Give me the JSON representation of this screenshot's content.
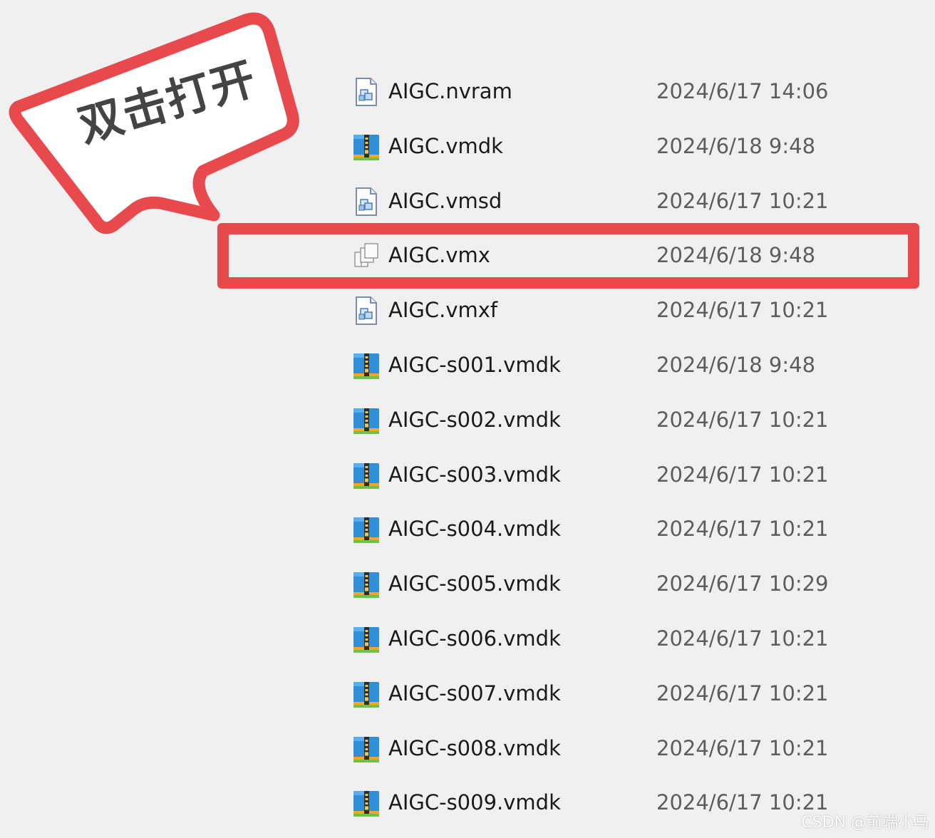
{
  "files": [
    {
      "name": "AIGC.nvram",
      "date": "2024/6/17 14:06",
      "icon": "vm-document-icon"
    },
    {
      "name": "AIGC.vmdk",
      "date": "2024/6/18 9:48",
      "icon": "disk-archive-icon"
    },
    {
      "name": "AIGC.vmsd",
      "date": "2024/6/17 10:21",
      "icon": "vm-document-icon"
    },
    {
      "name": "AIGC.vmx",
      "date": "2024/6/18 9:48",
      "icon": "vm-config-icon"
    },
    {
      "name": "AIGC.vmxf",
      "date": "2024/6/17 10:21",
      "icon": "vm-document-icon"
    },
    {
      "name": "AIGC-s001.vmdk",
      "date": "2024/6/18 9:48",
      "icon": "disk-archive-icon"
    },
    {
      "name": "AIGC-s002.vmdk",
      "date": "2024/6/17 10:21",
      "icon": "disk-archive-icon"
    },
    {
      "name": "AIGC-s003.vmdk",
      "date": "2024/6/17 10:21",
      "icon": "disk-archive-icon"
    },
    {
      "name": "AIGC-s004.vmdk",
      "date": "2024/6/17 10:21",
      "icon": "disk-archive-icon"
    },
    {
      "name": "AIGC-s005.vmdk",
      "date": "2024/6/17 10:29",
      "icon": "disk-archive-icon"
    },
    {
      "name": "AIGC-s006.vmdk",
      "date": "2024/6/17 10:21",
      "icon": "disk-archive-icon"
    },
    {
      "name": "AIGC-s007.vmdk",
      "date": "2024/6/17 10:21",
      "icon": "disk-archive-icon"
    },
    {
      "name": "AIGC-s008.vmdk",
      "date": "2024/6/17 10:21",
      "icon": "disk-archive-icon"
    },
    {
      "name": "AIGC-s009.vmdk",
      "date": "2024/6/17 10:21",
      "icon": "disk-archive-icon"
    }
  ],
  "annotation": {
    "callout_text": "双击打开",
    "highlight_color": "#e8494c"
  },
  "watermark": "CSDN @前端小马",
  "colors": {
    "background": "#f0f0f0",
    "name_text": "#1a1a1a",
    "date_text": "#5d5d5d"
  }
}
